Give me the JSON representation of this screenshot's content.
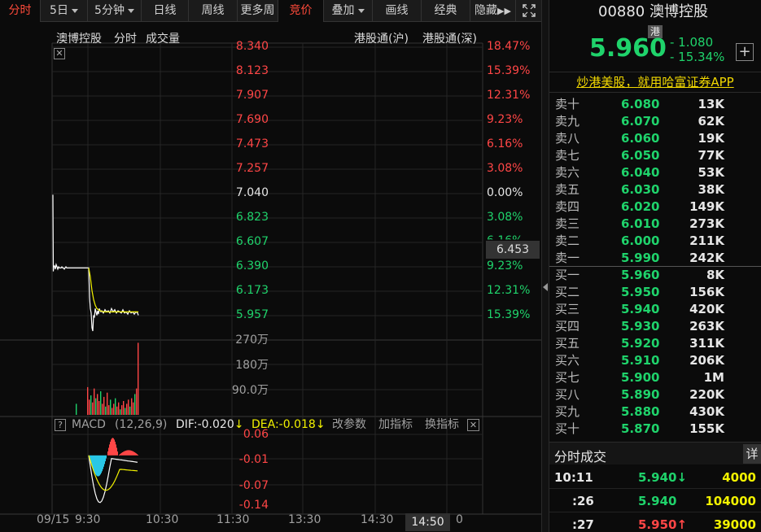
{
  "toolbar": {
    "tabs": [
      {
        "label": "分时"
      },
      {
        "label": "5日"
      },
      {
        "label": "5分钟"
      },
      {
        "label": "日线"
      },
      {
        "label": "周线"
      },
      {
        "label": "更多周"
      },
      {
        "label": "竞价"
      },
      {
        "label": "叠加"
      },
      {
        "label": "画线"
      },
      {
        "label": "经典"
      },
      {
        "label": "隐藏"
      }
    ],
    "active_tab": "竞价"
  },
  "chart_header": {
    "name": "澳博控股",
    "mode": "分时",
    "volume": "成交量",
    "hk_connect_sh": "港股通(沪)",
    "hk_connect_sz": "港股通(深)"
  },
  "price_axis": [
    "8.340",
    "8.123",
    "7.907",
    "7.690",
    "7.473",
    "7.257",
    "7.040",
    "6.823",
    "6.607",
    "6.390",
    "6.173",
    "5.957"
  ],
  "pct_axis": [
    "18.47%",
    "15.39%",
    "12.31%",
    "9.23%",
    "6.16%",
    "3.08%",
    "0.00%",
    "3.08%",
    "6.16%",
    "9.23%",
    "12.31%",
    "15.39%"
  ],
  "current_price_tag": "6.453",
  "volume_axis": [
    "270万",
    "180万",
    "90.0万"
  ],
  "macd": {
    "help": "?",
    "name": "MACD",
    "params": "(12,26,9)",
    "dif": "DIF:-0.020",
    "dea": "DEA:-0.018",
    "edit_params": "改参数",
    "add_indicator": "加指标",
    "switch_indicator": "换指标",
    "close": "✕",
    "axis": [
      "0.06",
      "-0.01",
      "-0.07",
      "-0.14"
    ]
  },
  "time_axis": [
    "09/15",
    "9:30",
    "10:30",
    "11:30",
    "13:30",
    "14:30",
    "0"
  ],
  "time_tag": "14:50",
  "panel": {
    "code": "00880",
    "name": "澳博控股",
    "market_badge": "港",
    "last_price": "5.960",
    "change": "- 1.080",
    "change_pct": "- 15.34%",
    "add": "+",
    "ad_text": "炒港美股，就用哈富证券APP"
  },
  "order_book": {
    "asks": [
      {
        "label": "卖十",
        "price": "6.080",
        "vol": "13K"
      },
      {
        "label": "卖九",
        "price": "6.070",
        "vol": "62K"
      },
      {
        "label": "卖八",
        "price": "6.060",
        "vol": "19K"
      },
      {
        "label": "卖七",
        "price": "6.050",
        "vol": "77K"
      },
      {
        "label": "卖六",
        "price": "6.040",
        "vol": "53K"
      },
      {
        "label": "卖五",
        "price": "6.030",
        "vol": "38K"
      },
      {
        "label": "卖四",
        "price": "6.020",
        "vol": "149K"
      },
      {
        "label": "卖三",
        "price": "6.010",
        "vol": "273K"
      },
      {
        "label": "卖二",
        "price": "6.000",
        "vol": "211K"
      },
      {
        "label": "卖一",
        "price": "5.990",
        "vol": "242K"
      }
    ],
    "bids": [
      {
        "label": "买一",
        "price": "5.960",
        "vol": "8K"
      },
      {
        "label": "买二",
        "price": "5.950",
        "vol": "156K"
      },
      {
        "label": "买三",
        "price": "5.940",
        "vol": "420K"
      },
      {
        "label": "买四",
        "price": "5.930",
        "vol": "263K"
      },
      {
        "label": "买五",
        "price": "5.920",
        "vol": "311K"
      },
      {
        "label": "买六",
        "price": "5.910",
        "vol": "206K"
      },
      {
        "label": "买七",
        "price": "5.900",
        "vol": "1M"
      },
      {
        "label": "买八",
        "price": "5.890",
        "vol": "220K"
      },
      {
        "label": "买九",
        "price": "5.880",
        "vol": "430K"
      },
      {
        "label": "买十",
        "price": "5.870",
        "vol": "155K"
      }
    ]
  },
  "trades": {
    "title": "分时成交",
    "detail": "详",
    "rows": [
      {
        "time": "10:11",
        "price": "5.940",
        "dir": "down",
        "vol": "4000"
      },
      {
        "time": ":26",
        "price": "5.940",
        "dir": "none",
        "vol": "104000"
      },
      {
        "time": ":27",
        "price": "5.950",
        "dir": "up",
        "vol": "39000"
      }
    ]
  },
  "colors": {
    "up": "#ff4646",
    "down": "#1fd36b",
    "active_tab": "#ff4a3a",
    "ad": "#f2d800",
    "volume_text": "#f2f200"
  }
}
